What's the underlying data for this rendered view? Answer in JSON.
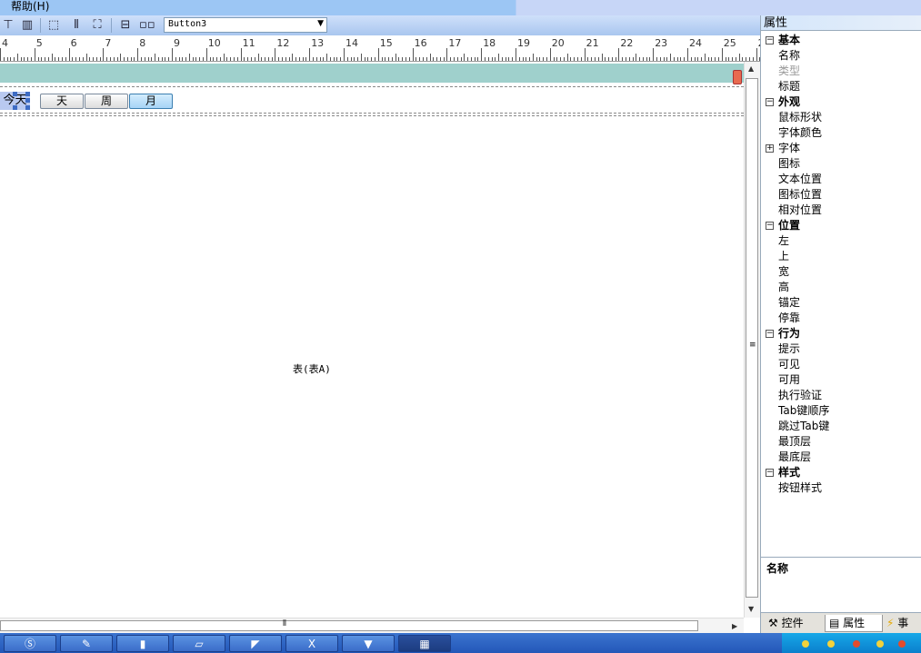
{
  "menu": {
    "help": "帮助(H)"
  },
  "toolbar": {
    "icons": [
      "align-icon",
      "bar-chart-icon",
      "frame-icon",
      "columns-icon",
      "fit-icon",
      "distribute-vertical-icon",
      "distribute-horizontal-icon"
    ],
    "combo_value": "Button3"
  },
  "ruler": {
    "numbers": [
      "4",
      "5",
      "6",
      "7",
      "8",
      "9",
      "10",
      "11",
      "12",
      "13",
      "14",
      "15",
      "16",
      "17",
      "18",
      "19",
      "20",
      "21",
      "22",
      "23",
      "24",
      "25",
      "2"
    ]
  },
  "design": {
    "today_button": "今天",
    "day_button": "天",
    "week_button": "周",
    "month_button": "月",
    "center_label": "表(表A)"
  },
  "panel": {
    "title": "属性",
    "rows": [
      {
        "kind": "cat",
        "box": "⊟",
        "label": "基本"
      },
      {
        "kind": "item",
        "label": "名称"
      },
      {
        "kind": "item",
        "label": "类型",
        "disabled": true
      },
      {
        "kind": "item",
        "label": "标题"
      },
      {
        "kind": "cat",
        "box": "⊟",
        "label": "外观"
      },
      {
        "kind": "item",
        "label": "鼠标形状"
      },
      {
        "kind": "item",
        "label": "字体颜色"
      },
      {
        "kind": "sub",
        "box": "⊞",
        "label": "字体"
      },
      {
        "kind": "item",
        "label": "图标"
      },
      {
        "kind": "item",
        "label": "文本位置"
      },
      {
        "kind": "item",
        "label": "图标位置"
      },
      {
        "kind": "item",
        "label": "相对位置"
      },
      {
        "kind": "cat",
        "box": "⊟",
        "label": "位置"
      },
      {
        "kind": "item",
        "label": "左"
      },
      {
        "kind": "item",
        "label": "上"
      },
      {
        "kind": "item",
        "label": "宽"
      },
      {
        "kind": "item",
        "label": "高"
      },
      {
        "kind": "item",
        "label": "锚定"
      },
      {
        "kind": "item",
        "label": "停靠"
      },
      {
        "kind": "cat",
        "box": "⊟",
        "label": "行为"
      },
      {
        "kind": "item",
        "label": "提示"
      },
      {
        "kind": "item",
        "label": "可见"
      },
      {
        "kind": "item",
        "label": "可用"
      },
      {
        "kind": "item",
        "label": "执行验证"
      },
      {
        "kind": "item",
        "label": "Tab键顺序"
      },
      {
        "kind": "item",
        "label": "跳过Tab键"
      },
      {
        "kind": "item",
        "label": "最顶层"
      },
      {
        "kind": "item",
        "label": "最底层"
      },
      {
        "kind": "cat",
        "box": "⊟",
        "label": "样式"
      },
      {
        "kind": "item",
        "label": "按钮样式"
      }
    ],
    "description_title": "名称",
    "tabs": [
      {
        "icon": "tools-icon",
        "label": "控件"
      },
      {
        "icon": "properties-icon",
        "label": "属性"
      },
      {
        "icon": "events-icon",
        "label": "事"
      }
    ]
  },
  "taskbar": {
    "apps": [
      "skype-icon",
      "app-red-icon",
      "app-yellow-icon",
      "app-window-icon",
      "app-chart-icon",
      "excel-icon",
      "app-fox-icon",
      "app-grid-icon"
    ]
  }
}
